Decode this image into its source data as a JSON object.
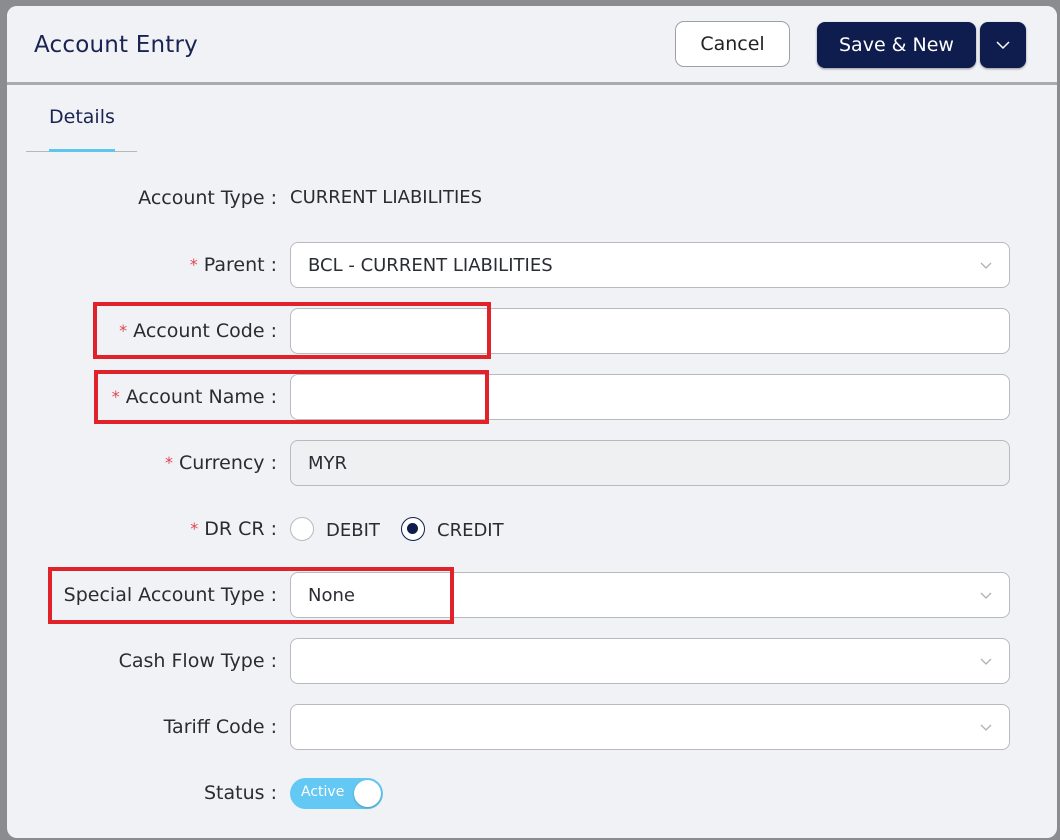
{
  "header": {
    "title": "Account Entry",
    "cancel_label": "Cancel",
    "save_label": "Save & New"
  },
  "tabs": [
    {
      "label": "Details",
      "active": true
    }
  ],
  "form": {
    "account_type": {
      "label": "Account Type :",
      "value": "CURRENT LIABILITIES"
    },
    "parent": {
      "label": "Parent :",
      "required": true,
      "value": "BCL - CURRENT LIABILITIES"
    },
    "account_code": {
      "label": "Account Code :",
      "required": true,
      "value": ""
    },
    "account_name": {
      "label": "Account Name :",
      "required": true,
      "value": ""
    },
    "currency": {
      "label": "Currency :",
      "required": true,
      "value": "MYR"
    },
    "dr_cr": {
      "label": "DR CR :",
      "required": true,
      "options": [
        "DEBIT",
        "CREDIT"
      ],
      "selected": "CREDIT"
    },
    "special_account_type": {
      "label": "Special Account Type :",
      "value": "None"
    },
    "cash_flow_type": {
      "label": "Cash Flow Type :",
      "value": ""
    },
    "tariff_code": {
      "label": "Tariff Code :",
      "value": ""
    },
    "status": {
      "label": "Status :",
      "value": "Active",
      "on": true
    }
  },
  "required_marker": "*",
  "colors": {
    "primary": "#0e1d4d",
    "accent": "#5fc4f0",
    "required": "#e0454f",
    "highlight": "#e0222a"
  }
}
